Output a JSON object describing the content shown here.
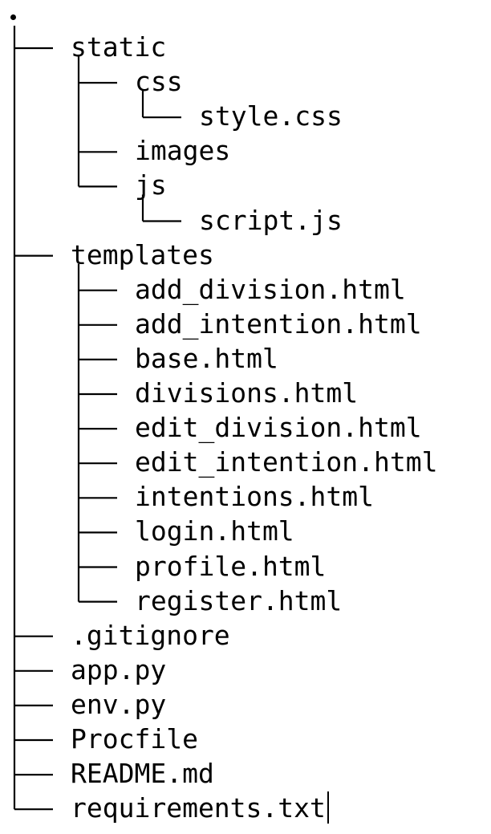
{
  "root": ".",
  "tree": [
    {
      "name": "static",
      "children": [
        {
          "name": "css",
          "children": [
            {
              "name": "style.css"
            }
          ]
        },
        {
          "name": "images"
        },
        {
          "name": "js",
          "children": [
            {
              "name": "script.js"
            }
          ]
        }
      ]
    },
    {
      "name": "templates",
      "children": [
        {
          "name": "add_division.html"
        },
        {
          "name": "add_intention.html"
        },
        {
          "name": "base.html"
        },
        {
          "name": "divisions.html"
        },
        {
          "name": "edit_division.html"
        },
        {
          "name": "edit_intention.html"
        },
        {
          "name": "intentions.html"
        },
        {
          "name": "login.html"
        },
        {
          "name": "profile.html"
        },
        {
          "name": "register.html"
        }
      ]
    },
    {
      "name": ".gitignore"
    },
    {
      "name": "app.py"
    },
    {
      "name": "env.py"
    },
    {
      "name": "Procfile"
    },
    {
      "name": "README.md"
    },
    {
      "name": "requirements.txt"
    }
  ],
  "colors": {
    "text": "#000000",
    "background": "#ffffff",
    "lines": "#000000"
  },
  "show_text_cursor": true
}
